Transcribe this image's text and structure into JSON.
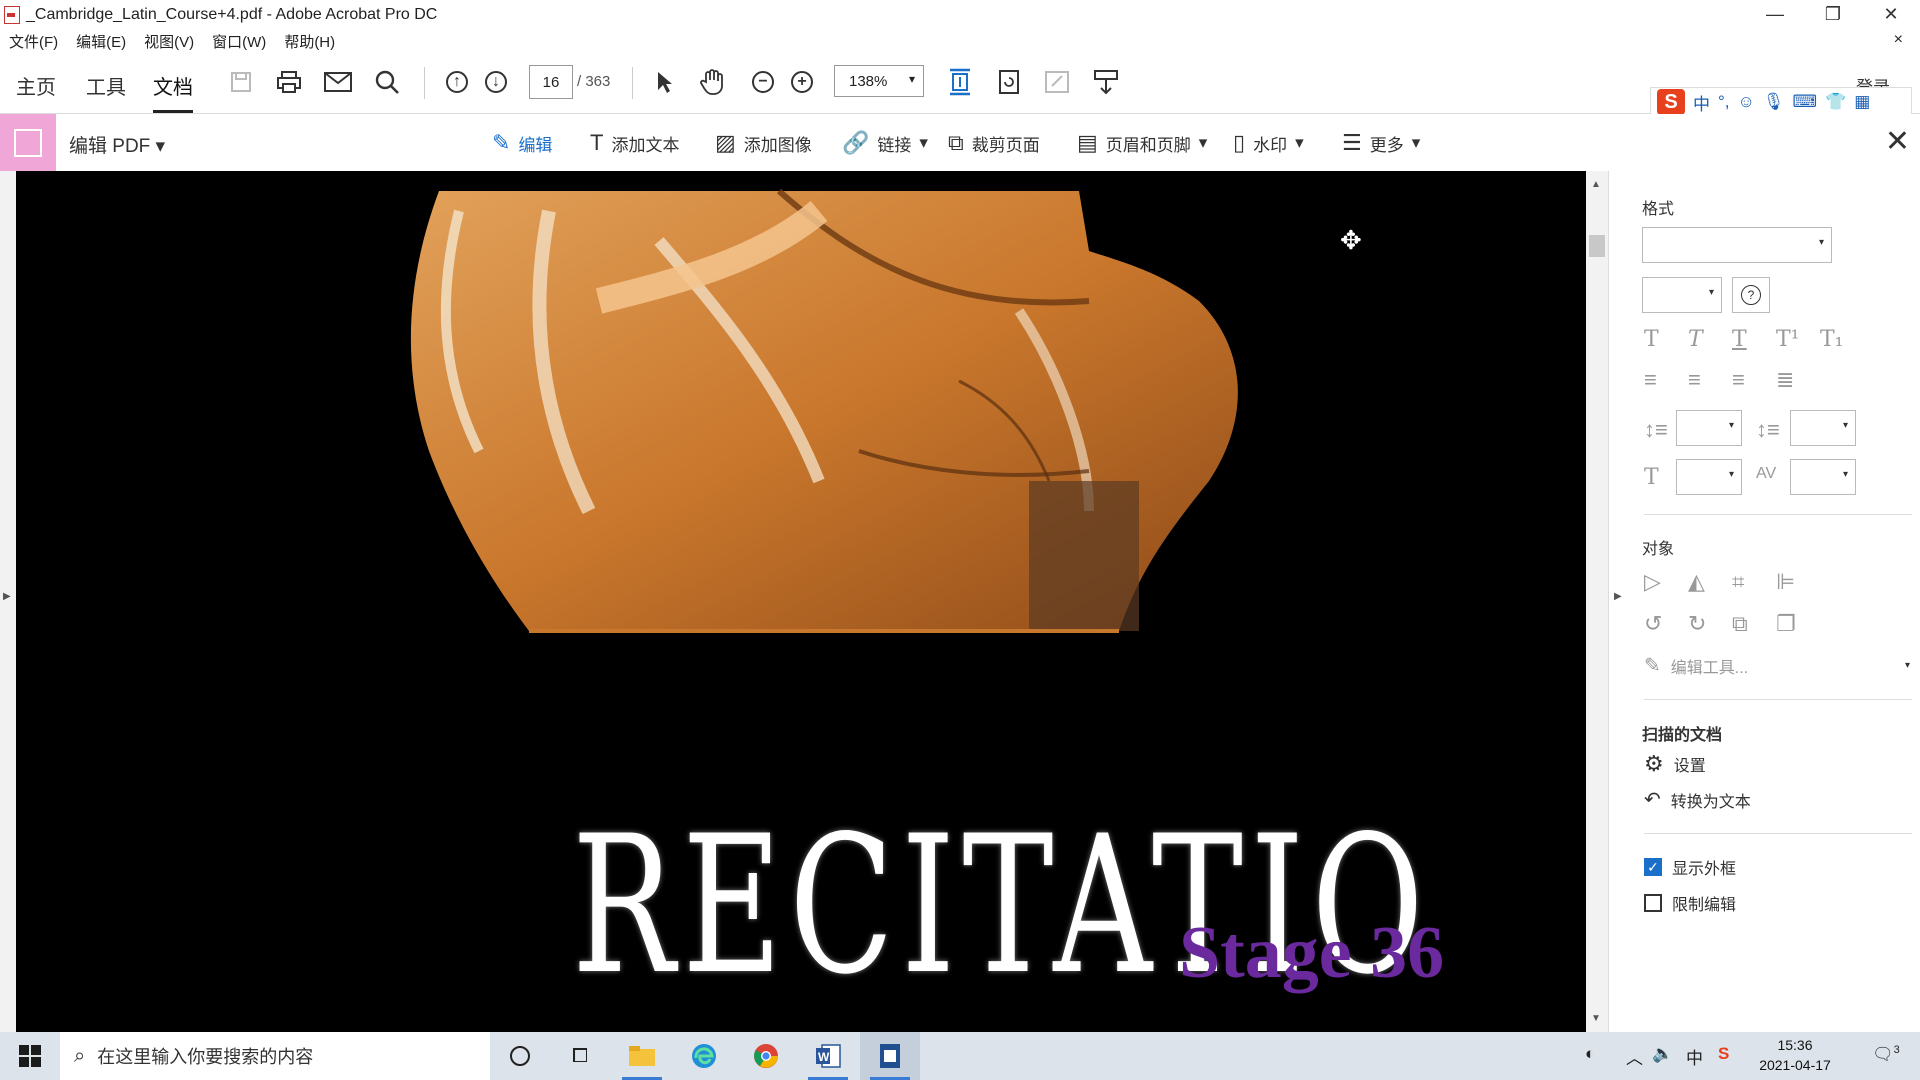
{
  "window": {
    "title": "_Cambridge_Latin_Course+4.pdf - Adobe Acrobat Pro DC",
    "controls": {
      "minimize": "—",
      "maximize": "❐",
      "close": "✕"
    }
  },
  "menu": {
    "items": [
      "文件(F)",
      "编辑(E)",
      "视图(V)",
      "窗口(W)",
      "帮助(H)"
    ],
    "close": "×"
  },
  "toolbar": {
    "tabs": [
      "主页",
      "工具",
      "文档"
    ],
    "active_tab": "文档",
    "page_current": "16",
    "page_total": "/ 363",
    "zoom": "138%",
    "signin": "登录"
  },
  "ime": {
    "logo": "S",
    "mode": "中"
  },
  "edit_bar": {
    "title": "编辑 PDF",
    "tools": [
      {
        "label": "编辑",
        "icon": "edit-icon",
        "dropdown": false
      },
      {
        "label": "添加文本",
        "icon": "add-text-icon",
        "dropdown": false
      },
      {
        "label": "添加图像",
        "icon": "add-image-icon",
        "dropdown": false
      },
      {
        "label": "链接",
        "icon": "link-icon",
        "dropdown": true
      },
      {
        "label": "裁剪页面",
        "icon": "crop-page-icon",
        "dropdown": false
      },
      {
        "label": "页眉和页脚",
        "icon": "header-footer-icon",
        "dropdown": true
      },
      {
        "label": "水印",
        "icon": "watermark-icon",
        "dropdown": true
      },
      {
        "label": "更多",
        "icon": "more-icon",
        "dropdown": true
      }
    ]
  },
  "document": {
    "heading": "RECITATIO",
    "subheading": "Stage 36"
  },
  "panel": {
    "format_header": "格式",
    "object_header": "对象",
    "edit_tools": "编辑工具...",
    "scanned_header": "扫描的文档",
    "settings": "设置",
    "convert_to_text": "转换为文本",
    "show_bounding_boxes": "显示外框",
    "show_bounding_boxes_checked": true,
    "restrict_editing": "限制编辑",
    "restrict_editing_checked": false
  },
  "taskbar": {
    "search_placeholder": "在这里输入你要搜索的内容",
    "tray_lang": "中",
    "time": "15:36",
    "date": "2021-04-17",
    "notifications": "3"
  },
  "colors": {
    "accent_blue": "#1a6fc9",
    "edit_pink": "#f0a6d6",
    "stage_purple": "#6a2a9e"
  }
}
